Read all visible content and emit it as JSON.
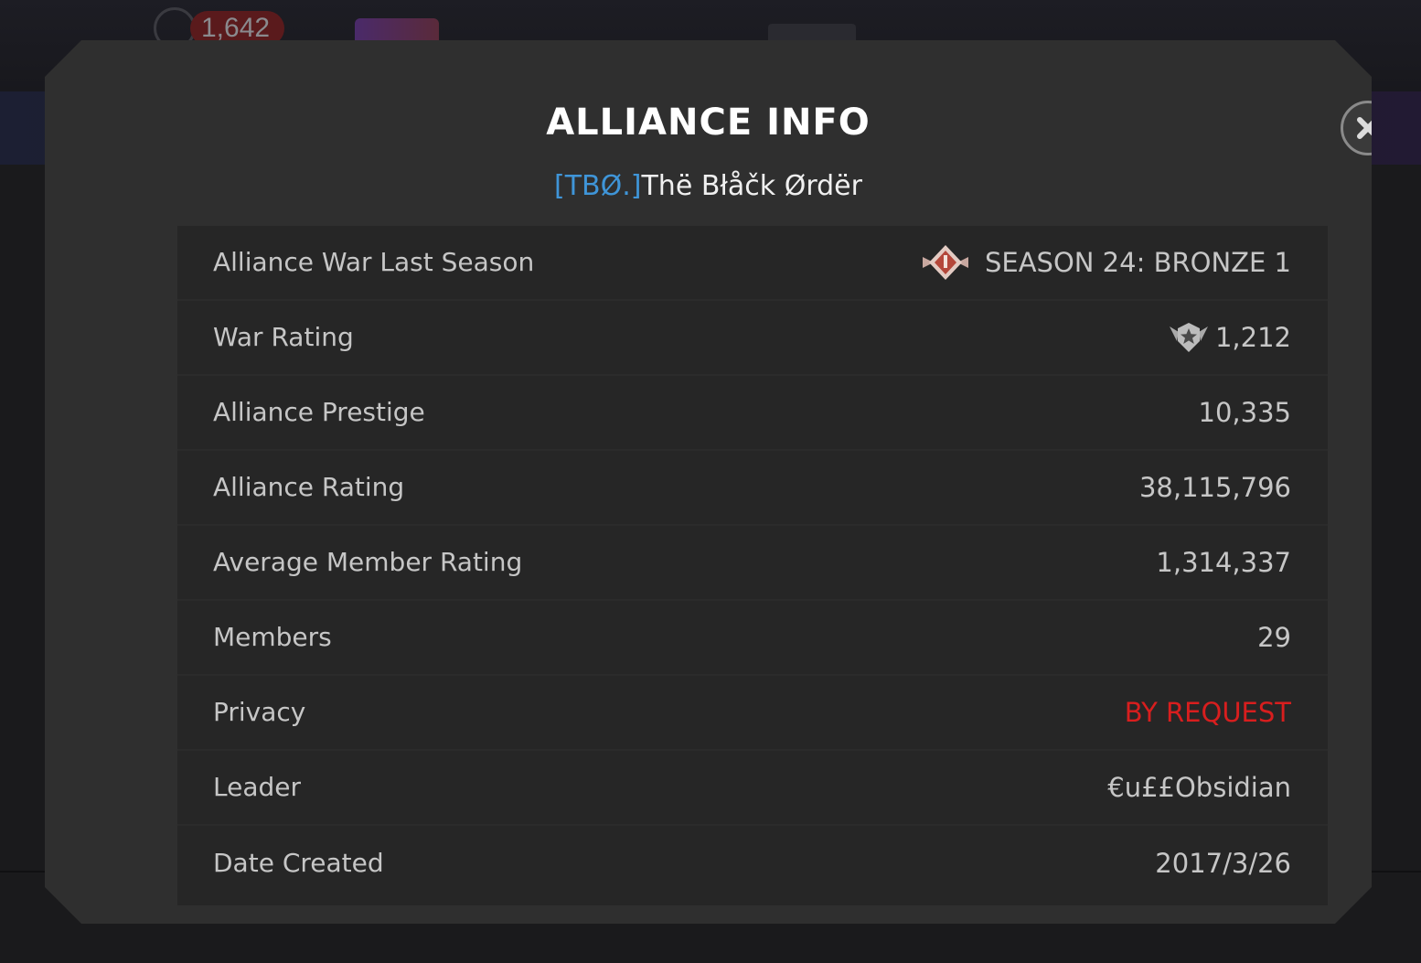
{
  "background": {
    "counter_value": "1,642"
  },
  "modal": {
    "title": "ALLIANCE INFO",
    "alliance_tag": "[TBØ.]",
    "alliance_name": "Thë Błåčk Ørdër"
  },
  "rows": [
    {
      "label": "Alliance War Last Season",
      "value": "SEASON 24: BRONZE 1",
      "icon": "bronze-season-emblem-icon"
    },
    {
      "label": "War Rating",
      "value": "1,212",
      "icon": "winged-star-emblem-icon"
    },
    {
      "label": "Alliance Prestige",
      "value": "10,335"
    },
    {
      "label": "Alliance Rating",
      "value": "38,115,796"
    },
    {
      "label": "Average Member Rating",
      "value": "1,314,337"
    },
    {
      "label": "Members",
      "value": "29"
    },
    {
      "label": "Privacy",
      "value": "BY REQUEST"
    },
    {
      "label": "Leader",
      "value": "€u££Obsidian"
    },
    {
      "label": "Date Created",
      "value": "2017/3/26"
    }
  ],
  "colors": {
    "modal_bg": "#2f2f2f",
    "table_bg": "#262626",
    "tag_blue": "#3f95d8",
    "privacy_red": "#d81e1e",
    "text_gray": "#c6c6c6"
  }
}
